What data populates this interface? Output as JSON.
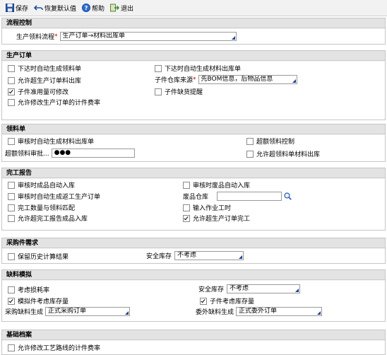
{
  "toolbar": {
    "save": "保存",
    "restore": "恢复默认值",
    "help": "帮助",
    "exit": "退出"
  },
  "flow": {
    "title": "流程控制",
    "label": "生产领料流程",
    "value": "生产订单→材料出库单"
  },
  "mo": {
    "title": "生产订单",
    "cb1": "下达时自动生成领料单",
    "cb2": "允许超生产订单料出库",
    "cb3": "子件准用量可修改",
    "cb4": "允许修改生产订单的计件费率",
    "cb5": "下达时自动生成材料出库单",
    "cb6": "子件缺货提醒",
    "source_label": "子件仓库来源",
    "source_value": "先BOM信息，后物品信息"
  },
  "pick": {
    "title": "领料单",
    "cb1": "审核时自动生成材料出库单",
    "cb2": "超额领料控制",
    "cb3": "允许超领料单材料出库",
    "approve_label": "超额领料审批...",
    "approve_value": "●●●"
  },
  "report": {
    "title": "完工报告",
    "cb1": "审核时成品自动入库",
    "cb2": "审核时自动生成返工生产订单",
    "cb3": "完工数量与领料匹配",
    "cb4": "允许超完工报告成品入库",
    "cb5": "审核时废品自动入库",
    "cb6": "输入作业工时",
    "cb7": "允许超生产订单完工",
    "waste_label": "废品仓库",
    "waste_value": ""
  },
  "purchase": {
    "title": "采购件需求",
    "cb1": "保留历史计算结果",
    "safety_label": "安全库存",
    "safety_value": "不考虑"
  },
  "shortage": {
    "title": "缺料模拟",
    "cb1": "考虑损耗率",
    "cb2": "模拟件考虑库存量",
    "cb3": "子件考虑库存量",
    "safety_label": "安全库存",
    "safety_value": "不考虑",
    "po_label": "采购缺料生成",
    "po_value": "正式采购订单",
    "ou_label": "委外缺料生成",
    "ou_value": "正式委外订单"
  },
  "base": {
    "title": "基础档案",
    "cb1": "允许修改工艺路线的计件费率"
  },
  "checked": {
    "mo_cb3": true,
    "mo_cb6": false,
    "report_cb7": true,
    "shortage_cb2": true,
    "shortage_cb3": true
  },
  "colors": {
    "input_corner": "#1f3f8f",
    "required": "#d00000",
    "section_header": "#e3e3e3"
  }
}
